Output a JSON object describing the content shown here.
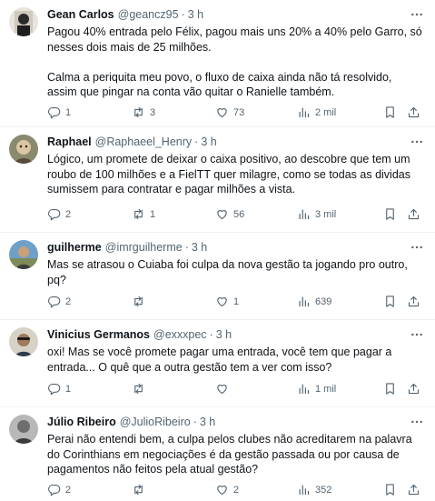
{
  "tweets": [
    {
      "name": "Gean Carlos",
      "handle": "@geancz95",
      "time": "3 h",
      "text": "Pagou 40% entrada pelo Félix, pagou mais uns 20% a 40% pelo Garro, só nesses dois mais de 25 milhões.\n\nCalma a periquita meu povo, o fluxo de caixa ainda não tá resolvido, assim que pingar na conta vão quitar o Ranielle também.",
      "replies": "1",
      "reposts": "3",
      "likes": "73",
      "views": "2 mil"
    },
    {
      "name": "Raphael",
      "handle": "@Raphaeel_Henry",
      "time": "3 h",
      "text": "Lógico, um promete de deixar o caixa positivo, ao descobre que tem um roubo de 100 milhões e a FielTT quer milagre, como se todas as dividas sumissem para contratar e pagar milhões a vista.",
      "replies": "2",
      "reposts": "1",
      "likes": "56",
      "views": "3 mil"
    },
    {
      "name": "guilherme",
      "handle": "@imrguilherme",
      "time": "3 h",
      "text": "Mas se atrasou o Cuiaba foi culpa da nova gestão ta jogando pro outro, pq?",
      "replies": "2",
      "reposts": "",
      "likes": "1",
      "views": "639"
    },
    {
      "name": "Vinicius Germanos",
      "handle": "@exxxpec",
      "time": "3 h",
      "text": "oxi! Mas se você promete pagar uma entrada, você tem que pagar a entrada... O quê que a outra gestão tem a ver com isso?",
      "replies": "1",
      "reposts": "",
      "likes": "",
      "views": "1 mil"
    },
    {
      "name": "Júlio Ribeiro",
      "handle": "@JulioRibeiro",
      "time": "3 h",
      "text": "Perai não entendi bem, a culpa pelos clubes não acreditarem na palavra do Corinthians em negociações é da gestão passada ou por causa de pagamentos não feitos pela atual gestão?",
      "replies": "2",
      "reposts": "",
      "likes": "2",
      "views": "352"
    }
  ],
  "colors": {
    "name": "#0f1419",
    "muted": "#536471",
    "divider": "#eff3f4"
  },
  "icons": [
    "more-icon",
    "reply-icon",
    "repost-icon",
    "like-icon",
    "views-icon",
    "bookmark-icon",
    "share-icon"
  ]
}
